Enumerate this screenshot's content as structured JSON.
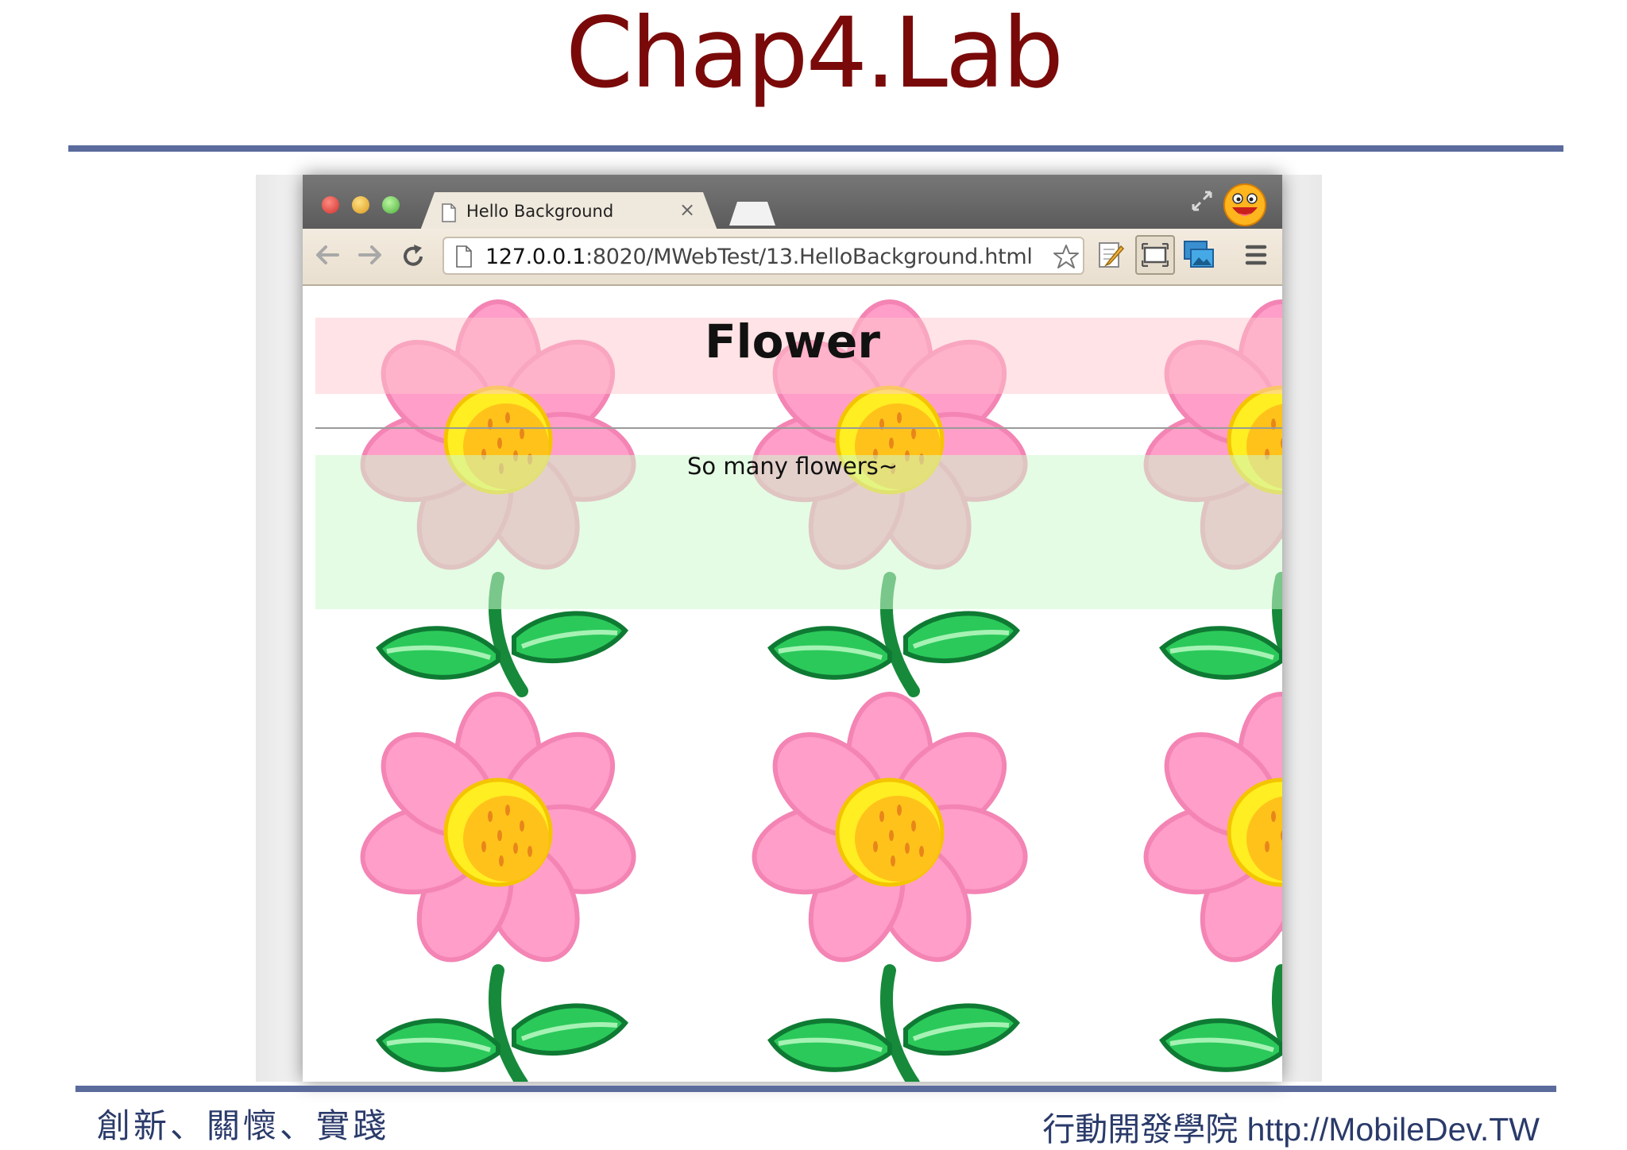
{
  "slide": {
    "title": "Chap4.Lab",
    "footer_left": "創新、關懷、實踐",
    "footer_right": "行動開發學院 http://MobileDev.TW"
  },
  "browser": {
    "tab_title": "Hello Background",
    "tab_close": "×",
    "url_host": "127.0.0.1",
    "url_rest": ":8020/MWebTest/13.HelloBackground.html"
  },
  "page": {
    "heading": "Flower",
    "paragraph": "So many flowers~"
  },
  "icons": [
    "document-icon",
    "back-arrow-icon",
    "forward-arrow-icon",
    "reload-icon",
    "star-icon",
    "note-edit-icon",
    "screen-capture-icon",
    "picture-icon",
    "menu-icon",
    "fullscreen-icon",
    "avatar-icon"
  ],
  "colors": {
    "title": "#7a0a0a",
    "rule": "#5a6b9c",
    "footer": "#2a3a6a",
    "pink_band": "#ffc8cd",
    "green_band": "#cdfacd"
  }
}
